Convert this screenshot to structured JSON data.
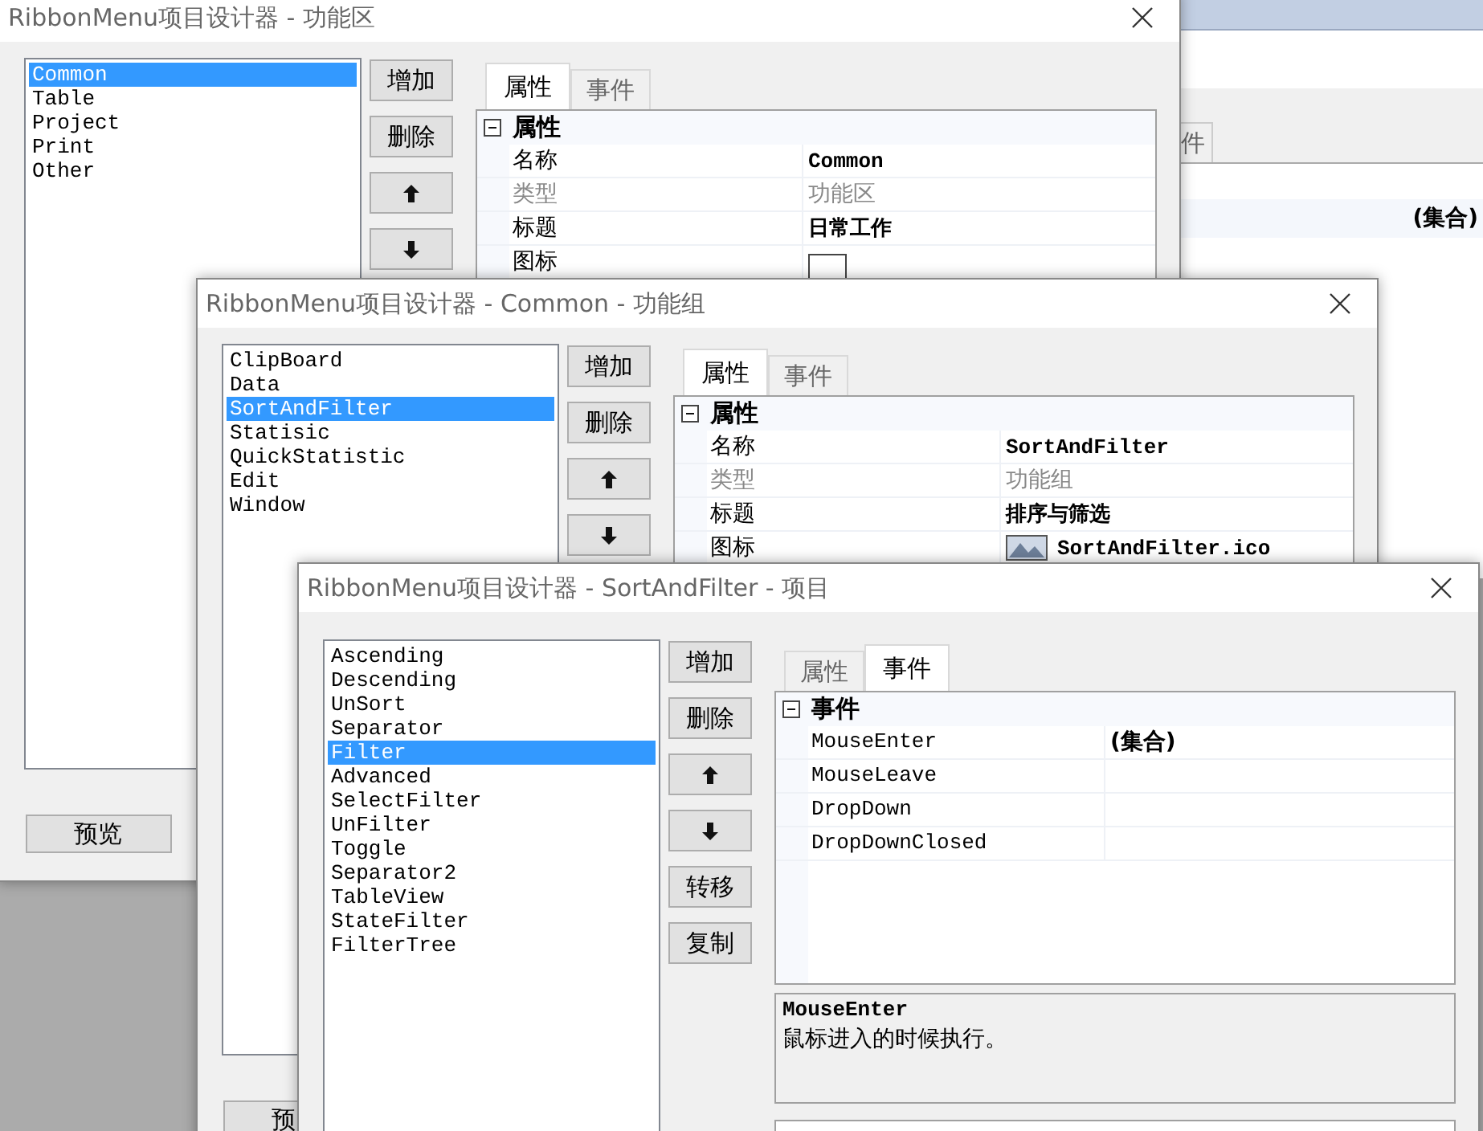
{
  "background_window": {
    "tab": "件",
    "value": "(集合)"
  },
  "windows": [
    {
      "title": "RibbonMenu项目设计器 - 功能区",
      "items": [
        {
          "label": "Common",
          "selected": true
        },
        {
          "label": "Table",
          "selected": false
        },
        {
          "label": "Project",
          "selected": false
        },
        {
          "label": "Print",
          "selected": false
        },
        {
          "label": "Other",
          "selected": false
        }
      ],
      "buttons": [
        {
          "kind": "text",
          "label": "增加"
        },
        {
          "kind": "text",
          "label": "删除"
        },
        {
          "kind": "up"
        },
        {
          "kind": "down"
        }
      ],
      "tabs": [
        {
          "label": "属性",
          "selected": true
        },
        {
          "label": "事件",
          "selected": false
        }
      ],
      "grid": {
        "kind": "properties",
        "category": "属性",
        "rows": [
          {
            "name": "名称",
            "value": "Common",
            "readonly": false
          },
          {
            "name": "类型",
            "value": "功能区",
            "readonly": true
          },
          {
            "name": "标题",
            "value": "日常工作",
            "readonly": false
          },
          {
            "name": "图标",
            "kind": "swatch",
            "readonly": false
          }
        ]
      },
      "footer_buttons": [
        "预览"
      ]
    },
    {
      "title": "RibbonMenu项目设计器 - Common - 功能组",
      "items": [
        {
          "label": "ClipBoard",
          "selected": false
        },
        {
          "label": "Data",
          "selected": false
        },
        {
          "label": "SortAndFilter",
          "selected": true
        },
        {
          "label": "Statisic",
          "selected": false
        },
        {
          "label": "QuickStatistic",
          "selected": false
        },
        {
          "label": "Edit",
          "selected": false
        },
        {
          "label": "Window",
          "selected": false
        }
      ],
      "buttons": [
        {
          "kind": "text",
          "label": "增加"
        },
        {
          "kind": "text",
          "label": "删除"
        },
        {
          "kind": "up"
        },
        {
          "kind": "down"
        }
      ],
      "tabs": [
        {
          "label": "属性",
          "selected": true
        },
        {
          "label": "事件",
          "selected": false
        }
      ],
      "grid": {
        "kind": "properties",
        "category": "属性",
        "rows": [
          {
            "name": "名称",
            "value": "SortAndFilter",
            "readonly": false
          },
          {
            "name": "类型",
            "value": "功能组",
            "readonly": true
          },
          {
            "name": "标题",
            "value": "排序与筛选",
            "readonly": false
          },
          {
            "name": "图标",
            "kind": "image",
            "value": "SortAndFilter.ico",
            "readonly": false
          }
        ]
      },
      "footer_buttons": [
        "预"
      ]
    },
    {
      "title": "RibbonMenu项目设计器 - SortAndFilter - 项目",
      "items": [
        {
          "label": "Ascending",
          "selected": false
        },
        {
          "label": "Descending",
          "selected": false
        },
        {
          "label": "UnSort",
          "selected": false
        },
        {
          "label": "Separator",
          "selected": false
        },
        {
          "label": "Filter",
          "selected": true
        },
        {
          "label": "Advanced",
          "selected": false
        },
        {
          "label": "SelectFilter",
          "selected": false
        },
        {
          "label": "UnFilter",
          "selected": false
        },
        {
          "label": "Toggle",
          "selected": false
        },
        {
          "label": "Separator2",
          "selected": false
        },
        {
          "label": "TableView",
          "selected": false
        },
        {
          "label": "StateFilter",
          "selected": false
        },
        {
          "label": "FilterTree",
          "selected": false
        }
      ],
      "buttons": [
        {
          "kind": "text",
          "label": "增加"
        },
        {
          "kind": "text",
          "label": "删除"
        },
        {
          "kind": "up"
        },
        {
          "kind": "down"
        },
        {
          "kind": "text",
          "label": "转移"
        },
        {
          "kind": "text",
          "label": "复制"
        }
      ],
      "tabs": [
        {
          "label": "属性",
          "selected": false
        },
        {
          "label": "事件",
          "selected": true
        }
      ],
      "grid": {
        "kind": "events",
        "category": "事件",
        "rows": [
          {
            "name": "MouseEnter",
            "value": "(集合)",
            "readonly": false
          },
          {
            "name": "MouseLeave",
            "readonly": false
          },
          {
            "name": "DropDown",
            "readonly": false
          },
          {
            "name": "DropDownClosed",
            "readonly": false
          }
        ]
      },
      "description": {
        "title": "MouseEnter",
        "text": "鼠标进入的时候执行。"
      }
    }
  ]
}
